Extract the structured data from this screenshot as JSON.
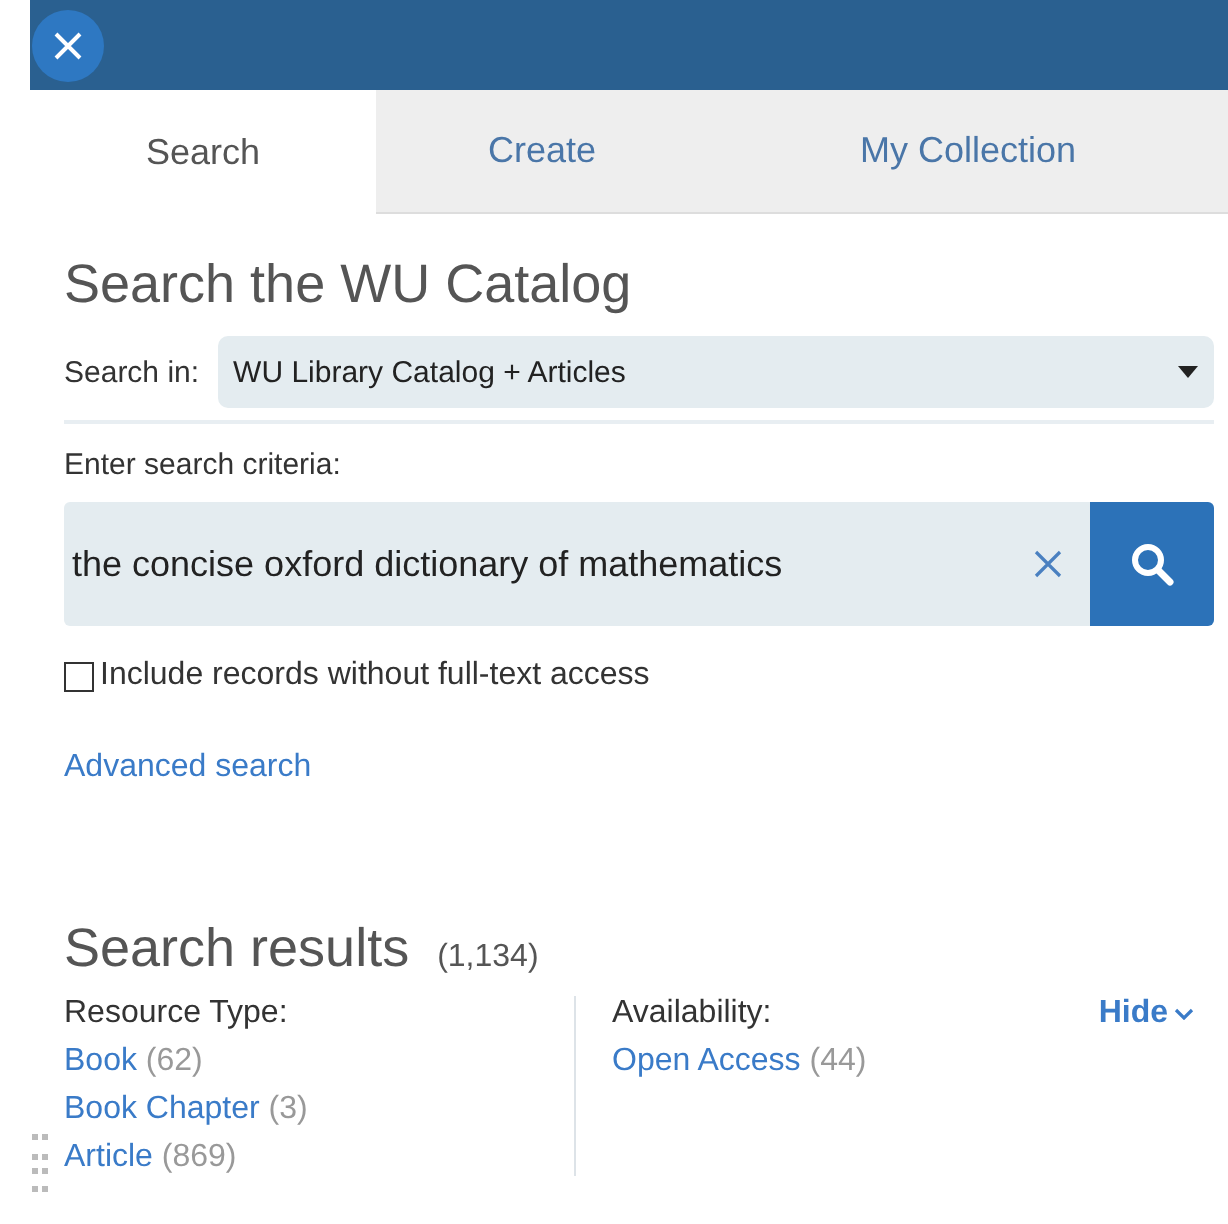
{
  "tabs": [
    {
      "label": "Search",
      "selected": true
    },
    {
      "label": "Create",
      "selected": false
    },
    {
      "label": "My Collection",
      "selected": false
    }
  ],
  "heading": "Search the WU Catalog",
  "search_in": {
    "label": "Search in:",
    "value": "WU Library Catalog + Articles"
  },
  "criteria": {
    "label": "Enter search criteria:",
    "value": "the concise oxford dictionary of mathematics"
  },
  "include_option": {
    "label": "Include records without full-text access",
    "checked": false
  },
  "advanced_link": "Advanced search",
  "results": {
    "title": "Search results",
    "count": "(1,134)",
    "hide": "Hide",
    "facets": [
      {
        "title": "Resource Type:",
        "items": [
          {
            "label": "Book",
            "count": "(62)"
          },
          {
            "label": "Book Chapter",
            "count": "(3)"
          },
          {
            "label": "Article",
            "count": "(869)"
          }
        ]
      },
      {
        "title": "Availability:",
        "items": [
          {
            "label": "Open Access",
            "count": "(44)"
          }
        ]
      }
    ]
  }
}
